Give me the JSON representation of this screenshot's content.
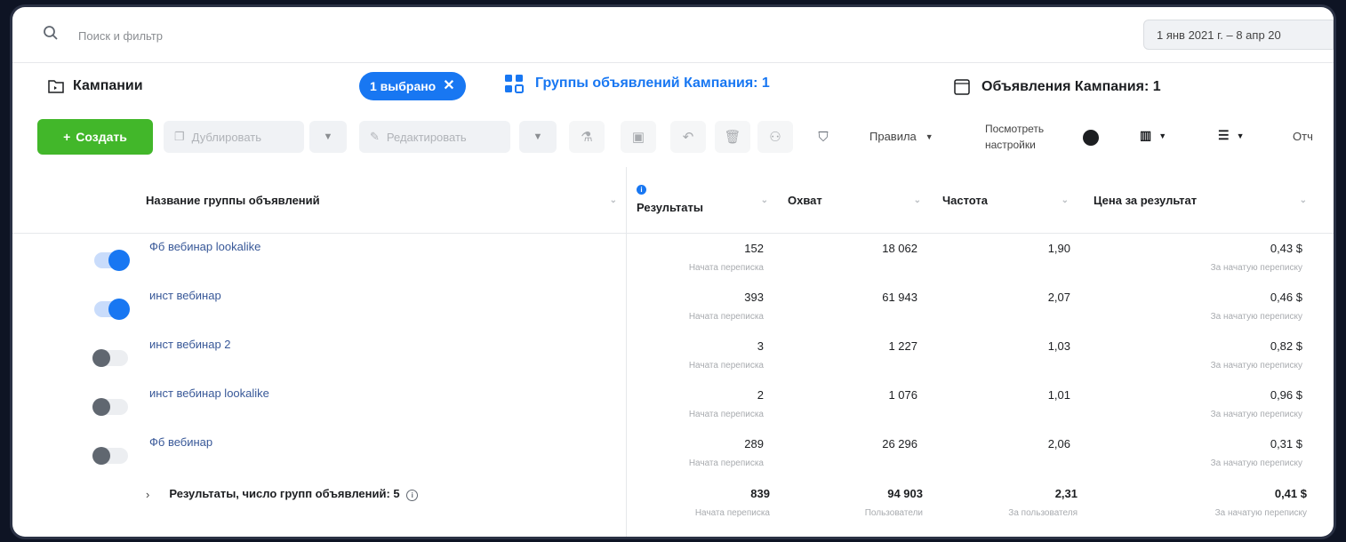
{
  "search": {
    "placeholder": "Поиск и фильтр"
  },
  "date_range": "1 янв 2021 г. – 8 апр 20",
  "tabs": {
    "campaigns": "Кампании",
    "selected_pill": "1 выбрано",
    "adsets": "Группы объявлений Кампания: 1",
    "ads": "Объявления Кампания: 1"
  },
  "toolbar": {
    "create": "Создать",
    "duplicate": "Дублировать",
    "edit": "Редактировать",
    "rules": "Правила",
    "view_settings": "Посмотреть настройки",
    "reports": "Отч"
  },
  "table": {
    "headers": {
      "name": "Название группы объявлений",
      "results": "Результаты",
      "reach": "Охват",
      "frequency": "Частота",
      "cost": "Цена за результат"
    },
    "rows": [
      {
        "name": "Фб вебинар lookalike",
        "active": true,
        "results": "152",
        "results_sub": "Начата переписка",
        "reach": "18 062",
        "frequency": "1,90",
        "cost": "0,43 $",
        "cost_sub": "За начатую переписку"
      },
      {
        "name": "инст вебинар",
        "active": true,
        "results": "393",
        "results_sub": "Начата переписка",
        "reach": "61 943",
        "frequency": "2,07",
        "cost": "0,46 $",
        "cost_sub": "За начатую переписку"
      },
      {
        "name": "инст вебинар 2",
        "active": false,
        "results": "3",
        "results_sub": "Начата переписка",
        "reach": "1 227",
        "frequency": "1,03",
        "cost": "0,82 $",
        "cost_sub": "За начатую переписку"
      },
      {
        "name": "инст вебинар lookalike",
        "active": false,
        "results": "2",
        "results_sub": "Начата переписка",
        "reach": "1 076",
        "frequency": "1,01",
        "cost": "0,96 $",
        "cost_sub": "За начатую переписку"
      },
      {
        "name": "Фб вебинар",
        "active": false,
        "results": "289",
        "results_sub": "Начата переписка",
        "reach": "26 296",
        "frequency": "2,06",
        "cost": "0,31 $",
        "cost_sub": "За начатую переписку"
      }
    ],
    "summary": {
      "label": "Результаты, число групп объявлений: 5",
      "results": "839",
      "results_sub": "Начата переписка",
      "reach": "94 903",
      "reach_sub": "Пользователи",
      "frequency": "2,31",
      "frequency_sub": "За пользователя",
      "cost": "0,41 $",
      "cost_sub": "За начатую переписку"
    }
  },
  "colors": {
    "accent": "#1877f2",
    "create": "#42b72a"
  }
}
